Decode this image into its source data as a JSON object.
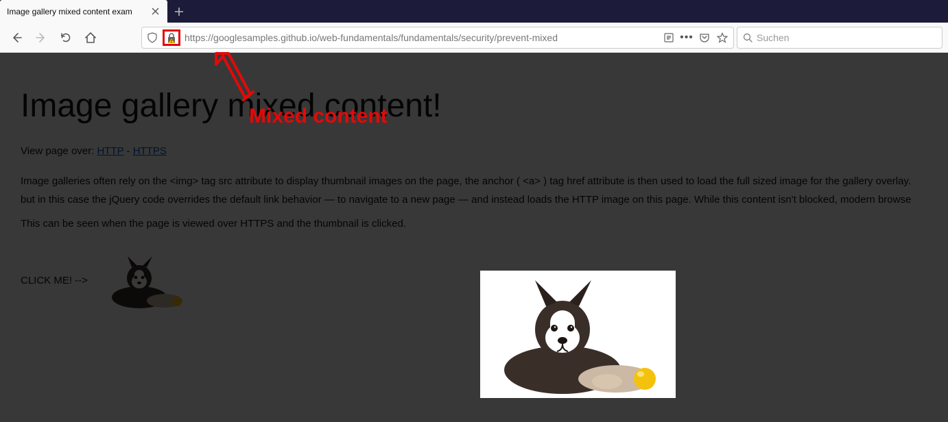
{
  "tab": {
    "title": "Image gallery mixed content exam"
  },
  "url": {
    "protocol": "https://",
    "domain": "googlesamples.github.io",
    "path": "/web-fundamentals/fundamentals/security/prevent-mixed"
  },
  "search": {
    "placeholder": "Suchen"
  },
  "page": {
    "heading": "Image gallery mixed content!",
    "view_prefix": "View page over: ",
    "http_label": "HTTP",
    "sep": " - ",
    "https_label": "HTTPS",
    "paragraph1": "Image galleries often rely on the <img> tag src attribute to display thumbnail images on the page, the anchor ( <a> ) tag href attribute is then used to load the full sized image for the gallery overlay. but in this case the jQuery code overrides the default link behavior — to navigate to a new page — and instead loads the HTTP image on this page. While this content isn't blocked, modern browse",
    "paragraph2": "This can be seen when the page is viewed over HTTPS and the thumbnail is clicked.",
    "click_label": "CLICK ME! -->"
  },
  "annotation": {
    "label": "Mixed content"
  }
}
